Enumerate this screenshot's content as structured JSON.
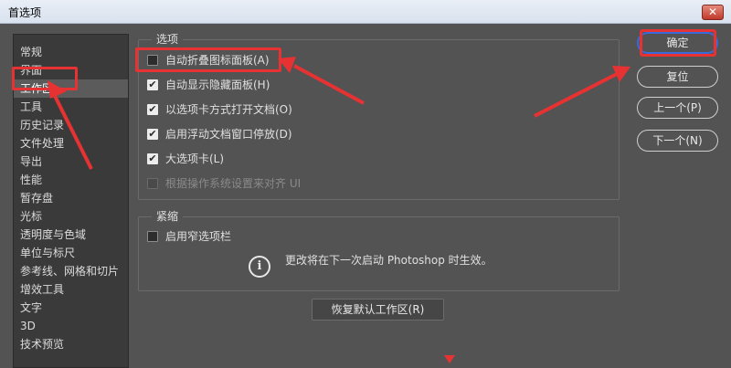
{
  "window": {
    "title": "首选项",
    "close_glyph": "✕"
  },
  "sidebar": {
    "items": [
      {
        "label": "常规"
      },
      {
        "label": "界面"
      },
      {
        "label": "工作区",
        "selected": true
      },
      {
        "label": "工具"
      },
      {
        "label": "历史记录"
      },
      {
        "label": "文件处理"
      },
      {
        "label": "导出"
      },
      {
        "label": "性能"
      },
      {
        "label": "暂存盘"
      },
      {
        "label": "光标"
      },
      {
        "label": "透明度与色域"
      },
      {
        "label": "单位与标尺"
      },
      {
        "label": "参考线、网格和切片"
      },
      {
        "label": "增效工具"
      },
      {
        "label": "文字"
      },
      {
        "label": "3D"
      },
      {
        "label": "技术预览"
      }
    ]
  },
  "options_group": {
    "label": "选项",
    "items": [
      {
        "label": "自动折叠图标面板(A)",
        "checked": false,
        "enabled": true
      },
      {
        "label": "自动显示隐藏面板(H)",
        "checked": true,
        "enabled": true
      },
      {
        "label": "以选项卡方式打开文档(O)",
        "checked": true,
        "enabled": true
      },
      {
        "label": "启用浮动文档窗口停放(D)",
        "checked": true,
        "enabled": true
      },
      {
        "label": "大选项卡(L)",
        "checked": true,
        "enabled": true
      },
      {
        "label": "根据操作系统设置来对齐 UI",
        "checked": false,
        "enabled": false
      }
    ]
  },
  "compact_group": {
    "label": "紧缩",
    "items": [
      {
        "label": "启用窄选项栏",
        "checked": false,
        "enabled": true
      }
    ],
    "info_icon": "i",
    "info_text": "更改将在下一次启动 Photoshop 时生效。"
  },
  "buttons": {
    "ok": "确定",
    "reset": "复位",
    "prev": "上一个(P)",
    "next": "下一个(N)",
    "restore_default": "恢复默认工作区(R)"
  },
  "checkmark_glyph": "✔",
  "colors": {
    "annotation_red": "#e63232",
    "primary_button_border": "#3a6ad9",
    "dialog_background": "#535353"
  }
}
